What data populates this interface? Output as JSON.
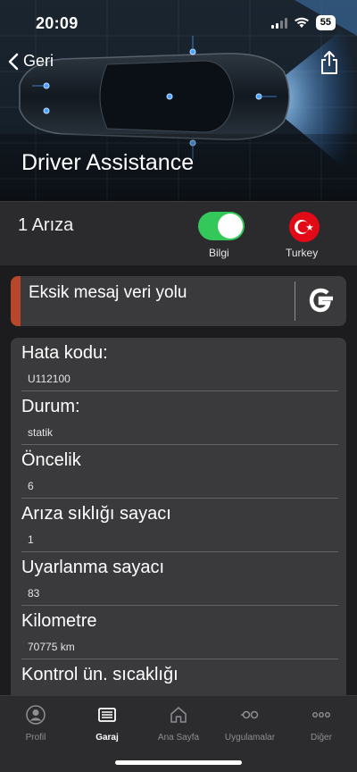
{
  "status_bar": {
    "time": "20:09",
    "battery": "55"
  },
  "header": {
    "back_label": "Geri",
    "title": "Driver Assistance"
  },
  "summary": {
    "fault_count": "1 Arıza",
    "toggle_label": "Bilgi",
    "toggle_on": true,
    "country_label": "Turkey"
  },
  "message": {
    "text": "Eksik mesaj veri yolu",
    "accent_color": "#b8462a"
  },
  "details": [
    {
      "label": "Hata kodu:",
      "value": "U112100"
    },
    {
      "label": "Durum:",
      "value": "statik"
    },
    {
      "label": "Öncelik",
      "value": "6"
    },
    {
      "label": "Arıza sıklığı sayacı",
      "value": "1"
    },
    {
      "label": "Uyarlanma sayacı",
      "value": "83"
    },
    {
      "label": "Kilometre",
      "value": "70775 km"
    },
    {
      "label": "Kontrol ün. sıcaklığı",
      "value": ""
    }
  ],
  "tabbar": {
    "tabs": [
      {
        "label": "Profil",
        "icon": "person-icon"
      },
      {
        "label": "Garaj",
        "icon": "garage-icon"
      },
      {
        "label": "Ana Sayfa",
        "icon": "home-icon"
      },
      {
        "label": "Uygulamalar",
        "icon": "apps-icon"
      },
      {
        "label": "Diğer",
        "icon": "more-icon"
      }
    ],
    "active": "Garaj"
  },
  "colors": {
    "toggle_on": "#34c759",
    "background": "#1c1c1e",
    "card": "#3a3a3c"
  }
}
